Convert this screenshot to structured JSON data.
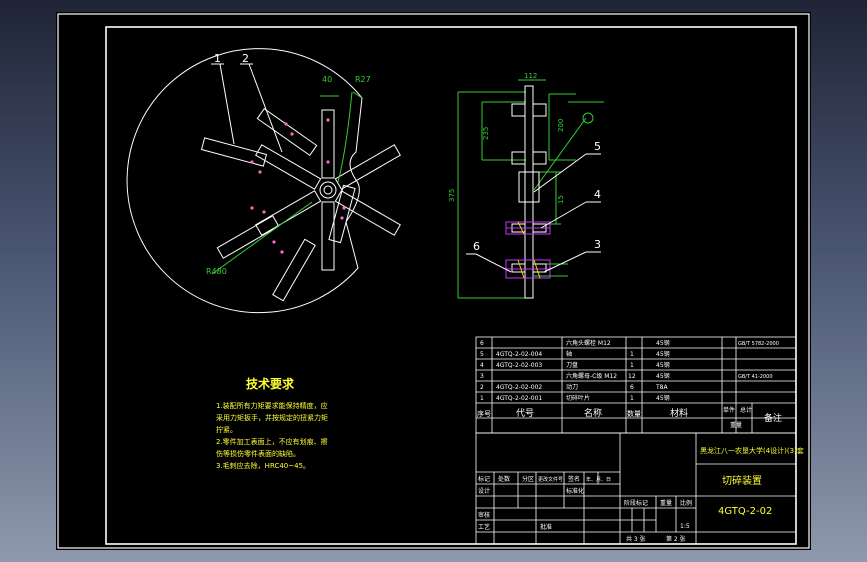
{
  "colors": {
    "background": "#000000",
    "frame": "#ffffff",
    "dimension": "#33cc33",
    "part_outline": "#ffffff",
    "annotation": "#ffffff",
    "heading": "#ffff33",
    "highlight": "#cc33ff",
    "hatch": "#ffcc00"
  },
  "drawing": {
    "callouts_left": [
      "1",
      "2"
    ],
    "dim_labels_left": [
      "40",
      "R27",
      "R480"
    ],
    "dim_labels_right": [
      "112",
      "235",
      "200",
      "375",
      "15"
    ],
    "callouts_right": [
      "5",
      "4",
      "3",
      "6"
    ]
  },
  "tech": {
    "heading": "技术要求",
    "lines": [
      "1.装配所有力矩要求能保持精度，应",
      "采用力矩扳手，并按规定的扭紧力矩",
      "拧紧。",
      "2.零件加工表面上，不应有划痕、擦",
      "伤等损伤零件表面的缺陷。",
      "3.毛刺应去除，HRC40~45。"
    ]
  },
  "bom": {
    "rows": [
      {
        "no": "6",
        "code": "",
        "name": "六角头螺栓 M12",
        "qty": "",
        "material": "45钢",
        "note": "GB/T 5782-2000"
      },
      {
        "no": "5",
        "code": "4GTQ-2-02-004",
        "name": "轴",
        "qty": "1",
        "material": "45钢",
        "note": ""
      },
      {
        "no": "4",
        "code": "4GTQ-2-02-003",
        "name": "刀盘",
        "qty": "1",
        "material": "45钢",
        "note": ""
      },
      {
        "no": "3",
        "code": "",
        "name": "六角螺母-C级 M12",
        "qty": "12",
        "material": "45钢",
        "note": "GB/T 41-2000"
      },
      {
        "no": "2",
        "code": "4GTQ-2-02-002",
        "name": "动刀",
        "qty": "6",
        "material": "T8A",
        "note": ""
      },
      {
        "no": "1",
        "code": "4GTQ-2-02-001",
        "name": "切碎叶片",
        "qty": "1",
        "material": "45钢",
        "note": ""
      }
    ],
    "header": {
      "no": "序号",
      "code": "代号",
      "name": "名称",
      "qty": "数量",
      "material": "材料",
      "single": "单件",
      "total": "总计",
      "weight": "重量",
      "note": "备注"
    }
  },
  "title_block": {
    "company": "黑龙江八一农垦大学(4设计)(3)套",
    "drawing_name": "切碎装置",
    "drawing_no": "4GTQ-2-02",
    "scale": "1:5",
    "sheets_total": "共 3 张",
    "sheet_no": "第 2 张",
    "row_labels": {
      "mark": "标记",
      "count": "处数",
      "zone": "分区",
      "change_doc": "更改文件号",
      "sign": "签名",
      "date": "年、月、日",
      "design": "设计",
      "process": "工艺",
      "check": "审核",
      "standard": "标准化",
      "approve": "批准",
      "stage_mark": "阶段标记",
      "weight": "重量",
      "scale_label": "比例"
    }
  }
}
